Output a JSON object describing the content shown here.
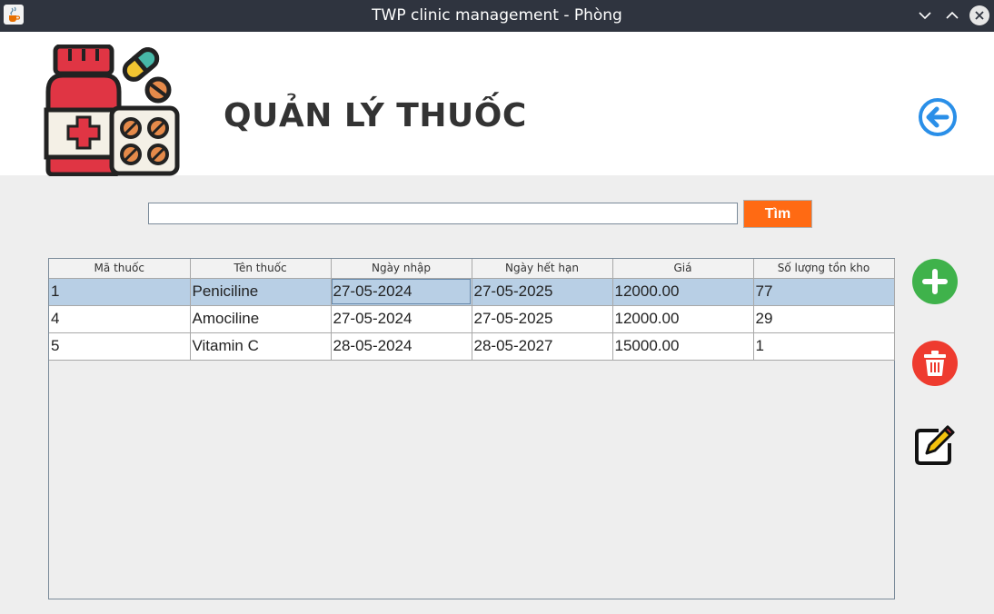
{
  "window": {
    "title": "TWP clinic management - Phòng"
  },
  "header": {
    "title": "QUẢN LÝ THUỐC"
  },
  "search": {
    "value": "",
    "button_label": "Tìm"
  },
  "table": {
    "columns": [
      "Mã thuốc",
      "Tên thuốc",
      "Ngày nhập",
      "Ngày hết hạn",
      "Giá",
      "Số lượng tồn kho"
    ],
    "rows": [
      [
        "1",
        "Peniciline",
        "27-05-2024",
        "27-05-2025",
        "12000.00",
        "77"
      ],
      [
        "4",
        "Amociline",
        "27-05-2024",
        "27-05-2025",
        "12000.00",
        "29"
      ],
      [
        "5",
        "Vitamin C",
        "28-05-2024",
        "28-05-2027",
        "15000.00",
        "1"
      ]
    ],
    "selected_row": 0
  },
  "actions": {
    "add_icon": "plus-icon",
    "delete_icon": "trash-icon",
    "edit_icon": "edit-icon"
  },
  "colors": {
    "titlebar": "#2f343f",
    "search_button": "#ff6a13",
    "add": "#3fb24b",
    "delete": "#ee3b2f",
    "selection": "#b8cfe5",
    "back": "#2a8fe8"
  }
}
